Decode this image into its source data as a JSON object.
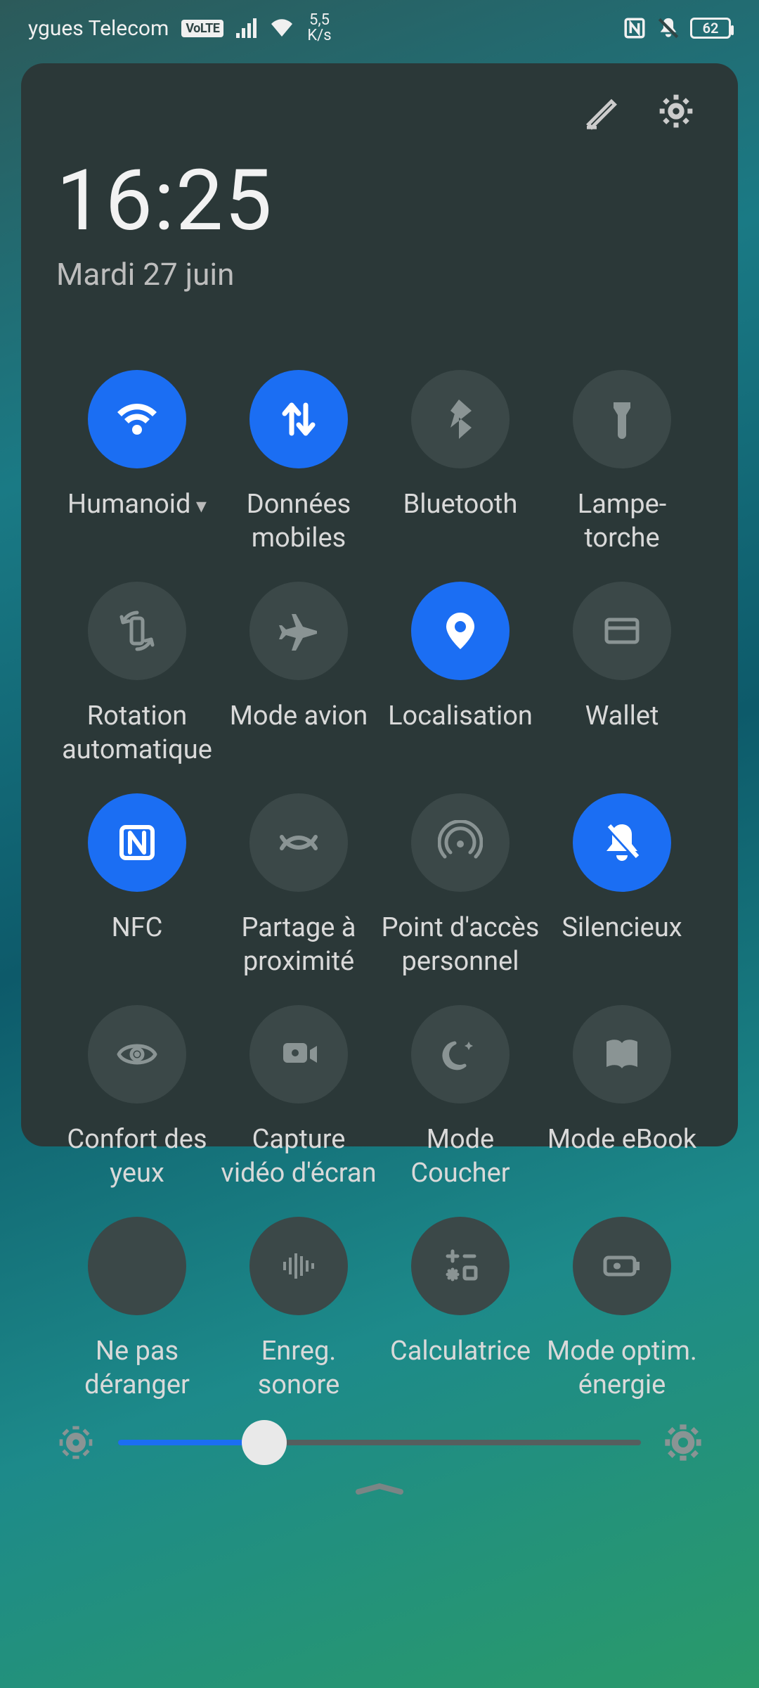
{
  "status": {
    "carrier": "ygues Telecom",
    "volte": "VoLTE",
    "speed_top": "5,5",
    "speed_bottom": "K/s",
    "battery": "62"
  },
  "clock": {
    "time": "16:25",
    "date": "Mardi 27 juin"
  },
  "tiles": [
    {
      "id": "wifi",
      "label": "Humanoid",
      "active": true,
      "caret": true,
      "icon": "wifi"
    },
    {
      "id": "data",
      "label": "Données mobiles",
      "active": true,
      "caret": false,
      "icon": "data"
    },
    {
      "id": "bluetooth",
      "label": "Bluetooth",
      "active": false,
      "caret": false,
      "icon": "bluetooth"
    },
    {
      "id": "torch",
      "label": "Lampe-torche",
      "active": false,
      "caret": false,
      "icon": "flashlight"
    },
    {
      "id": "rotation",
      "label": "Rotation automatique",
      "active": false,
      "caret": false,
      "icon": "rotation"
    },
    {
      "id": "airplane",
      "label": "Mode avion",
      "active": false,
      "caret": false,
      "icon": "airplane"
    },
    {
      "id": "location",
      "label": "Localisation",
      "active": true,
      "caret": false,
      "icon": "location"
    },
    {
      "id": "wallet",
      "label": "Wallet",
      "active": false,
      "caret": false,
      "icon": "wallet"
    },
    {
      "id": "nfc",
      "label": "NFC",
      "active": true,
      "caret": false,
      "icon": "nfc"
    },
    {
      "id": "nearby",
      "label": "Partage à proximité",
      "active": false,
      "caret": false,
      "icon": "nearby"
    },
    {
      "id": "hotspot",
      "label": "Point d'accès personnel",
      "active": false,
      "caret": false,
      "icon": "hotspot"
    },
    {
      "id": "silent",
      "label": "Silencieux",
      "active": true,
      "caret": false,
      "icon": "silent"
    },
    {
      "id": "eyecomfort",
      "label": "Confort des yeux",
      "active": false,
      "caret": false,
      "icon": "eye"
    },
    {
      "id": "screenrec",
      "label": "Capture vidéo d'écran",
      "active": false,
      "caret": false,
      "icon": "screenrec"
    },
    {
      "id": "bedtime",
      "label": "Mode Coucher",
      "active": false,
      "caret": false,
      "icon": "bedtime"
    },
    {
      "id": "ebook",
      "label": "Mode eBook",
      "active": false,
      "caret": false,
      "icon": "ebook"
    },
    {
      "id": "dnd",
      "label": "Ne pas déranger",
      "active": false,
      "caret": false,
      "icon": "dnd"
    },
    {
      "id": "soundrec",
      "label": "Enreg. sonore",
      "active": false,
      "caret": false,
      "icon": "soundrec"
    },
    {
      "id": "calc",
      "label": "Calculatrice",
      "active": false,
      "caret": false,
      "icon": "calc"
    },
    {
      "id": "battery",
      "label": "Mode optim. énergie",
      "active": false,
      "caret": false,
      "icon": "battery"
    }
  ],
  "brightness": {
    "percent": 28
  }
}
